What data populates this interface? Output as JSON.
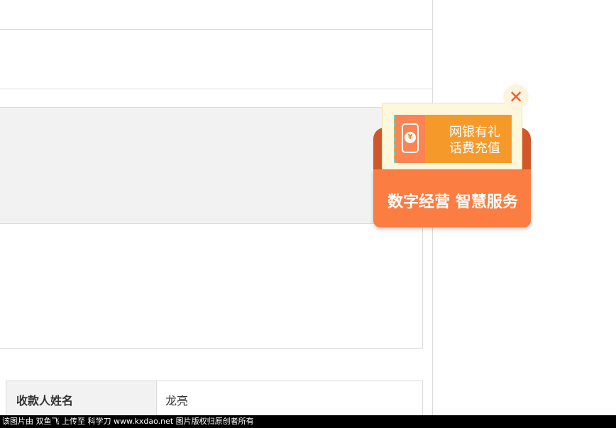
{
  "receipt": {
    "payee_name_label": "收款人姓名",
    "payee_name_value": "龙亮"
  },
  "ad": {
    "coin_symbol": "¥",
    "ticket_line1": "网银有礼",
    "ticket_line2": "话费充值",
    "slogan": "数字经营 智慧服务",
    "close_symbol": "✕"
  },
  "footer": {
    "text": "该图片由 双鱼飞 上传至 科学刀 www.kxdao.net 图片版权归原创者所有"
  }
}
